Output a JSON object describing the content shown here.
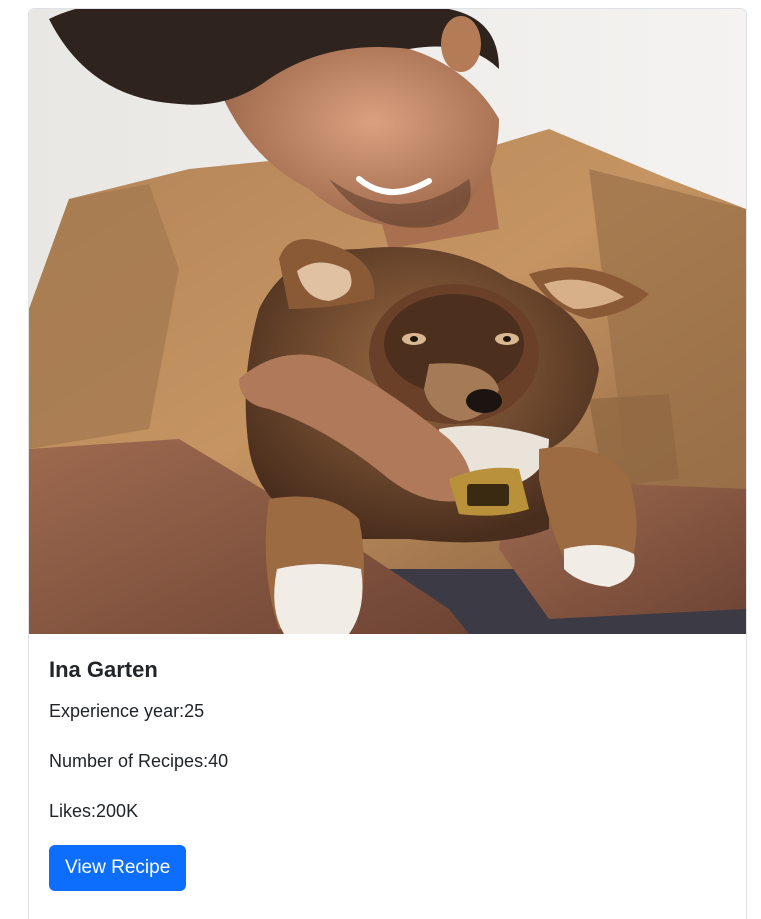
{
  "card": {
    "image_alt": "man hugging a brown puppy",
    "name": "Ina Garten",
    "experience_label": "Experience year:",
    "experience_value": "25",
    "recipes_label": "Number of Recipes:",
    "recipes_value": "40",
    "likes_label": "Likes:",
    "likes_value": "200K",
    "button_label": "View Recipe"
  },
  "colors": {
    "primary": "#0d6efd",
    "text": "#212529",
    "border": "#dee2e6"
  }
}
